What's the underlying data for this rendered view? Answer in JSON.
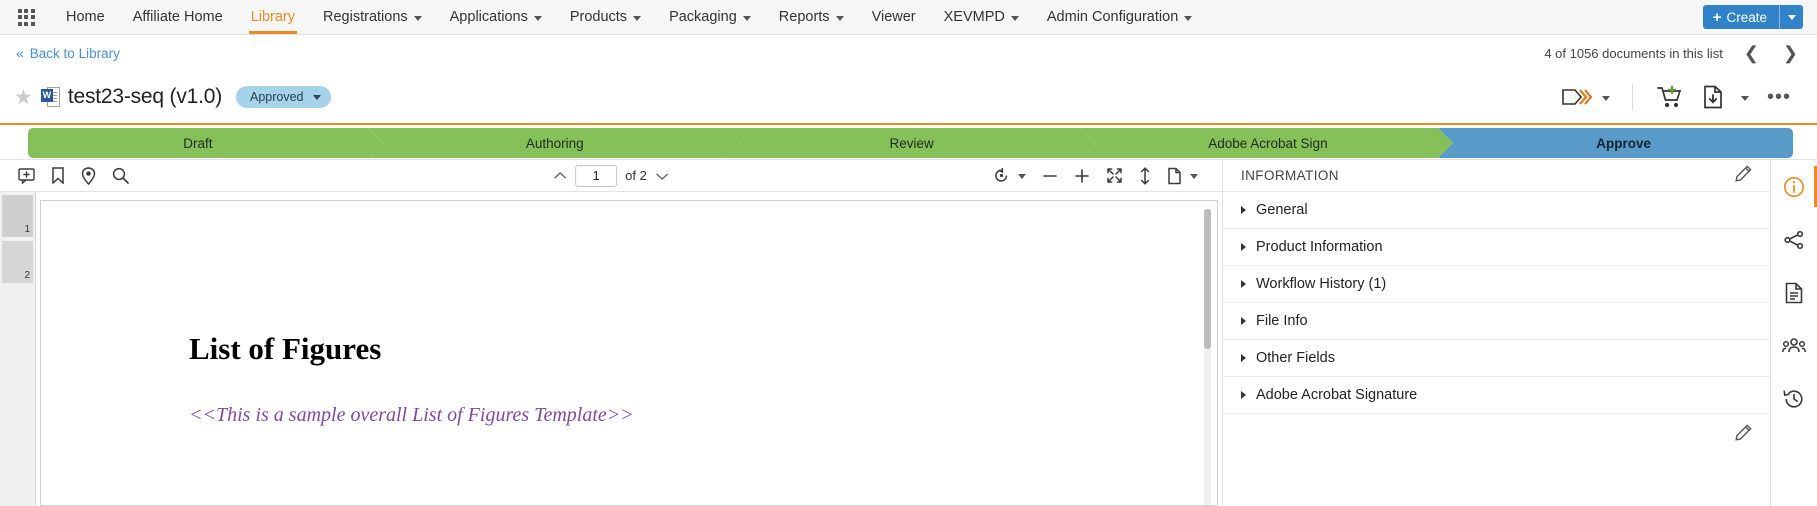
{
  "topnav": {
    "apps_icon": "waffle-grid-icon",
    "items": [
      {
        "label": "Home",
        "has_caret": false,
        "active": false
      },
      {
        "label": "Affiliate Home",
        "has_caret": false,
        "active": false
      },
      {
        "label": "Library",
        "has_caret": false,
        "active": true
      },
      {
        "label": "Registrations",
        "has_caret": true,
        "active": false
      },
      {
        "label": "Applications",
        "has_caret": true,
        "active": false
      },
      {
        "label": "Products",
        "has_caret": true,
        "active": false
      },
      {
        "label": "Packaging",
        "has_caret": true,
        "active": false
      },
      {
        "label": "Reports",
        "has_caret": true,
        "active": false
      },
      {
        "label": "Viewer",
        "has_caret": false,
        "active": false
      },
      {
        "label": "XEVMPD",
        "has_caret": true,
        "active": false
      },
      {
        "label": "Admin Configuration",
        "has_caret": true,
        "active": false
      }
    ],
    "create_button": {
      "label": "Create",
      "plus": "+",
      "accent_color": "#3083c9"
    }
  },
  "subbar": {
    "back_link": "Back to Library",
    "back_chevron": "«",
    "doc_count": "4 of 1056 documents in this list",
    "prev_arrow": "❮",
    "next_arrow": "❯"
  },
  "title_row": {
    "star_icon": "star-icon",
    "star_glyph": "★",
    "doc_icon": "word-document-icon",
    "doc_icon_letter": "W",
    "title": "test23-seq (v1.0)",
    "status_badge": "Approved",
    "actions": [
      {
        "name": "send-workflow-icon",
        "has_caret": true
      },
      {
        "name": "add-to-cart-icon",
        "has_caret": false
      },
      {
        "name": "download-document-icon",
        "has_caret": true
      },
      {
        "name": "more-actions-icon",
        "label": "•••"
      }
    ]
  },
  "workflow": {
    "accent_color": "#ec8b24",
    "stage_color": "#86c059",
    "current_color": "#589bc8",
    "stages": [
      {
        "label": "Draft",
        "state": "done"
      },
      {
        "label": "Authoring",
        "state": "done"
      },
      {
        "label": "Review",
        "state": "done"
      },
      {
        "label": "Adobe Acrobat Sign",
        "state": "done"
      },
      {
        "label": "Approve",
        "state": "current"
      }
    ]
  },
  "viewer": {
    "toolbar_left": [
      {
        "name": "add-comment-icon"
      },
      {
        "name": "bookmark-icon"
      },
      {
        "name": "location-pin-icon"
      },
      {
        "name": "search-icon"
      }
    ],
    "page_up_icon": "chevron-up-icon",
    "page_number": "1",
    "page_total": "of 2",
    "page_down_icon": "chevron-down-icon",
    "toolbar_right": [
      {
        "name": "rotate-icon",
        "has_caret": true
      },
      {
        "name": "zoom-out-icon"
      },
      {
        "name": "zoom-in-icon"
      },
      {
        "name": "fit-page-icon"
      },
      {
        "name": "fit-height-icon"
      },
      {
        "name": "page-layout-icon",
        "has_caret": true
      }
    ],
    "thumbnails": [
      {
        "number": "1",
        "selected": true
      },
      {
        "number": "2",
        "selected": false
      }
    ],
    "document": {
      "heading": "List of Figures",
      "subtext": "<<This is a sample overall List of Figures Template>>",
      "subtext_color": "#7a4ca8"
    }
  },
  "info_panel": {
    "title": "INFORMATION",
    "edit_icon": "pencil-icon",
    "footer_edit_icon": "pencil-icon",
    "sections": [
      {
        "label": "General"
      },
      {
        "label": "Product Information"
      },
      {
        "label": "Workflow History (1)"
      },
      {
        "label": "File Info"
      },
      {
        "label": "Other Fields"
      },
      {
        "label": "Adobe Acrobat Signature"
      }
    ]
  },
  "rail": {
    "active_color": "#ec8b24",
    "items": [
      {
        "name": "info-icon",
        "active": true
      },
      {
        "name": "workflow-branch-icon",
        "active": false
      },
      {
        "name": "document-icon",
        "active": false
      },
      {
        "name": "users-group-icon",
        "active": false
      },
      {
        "name": "history-icon",
        "active": false
      }
    ]
  }
}
